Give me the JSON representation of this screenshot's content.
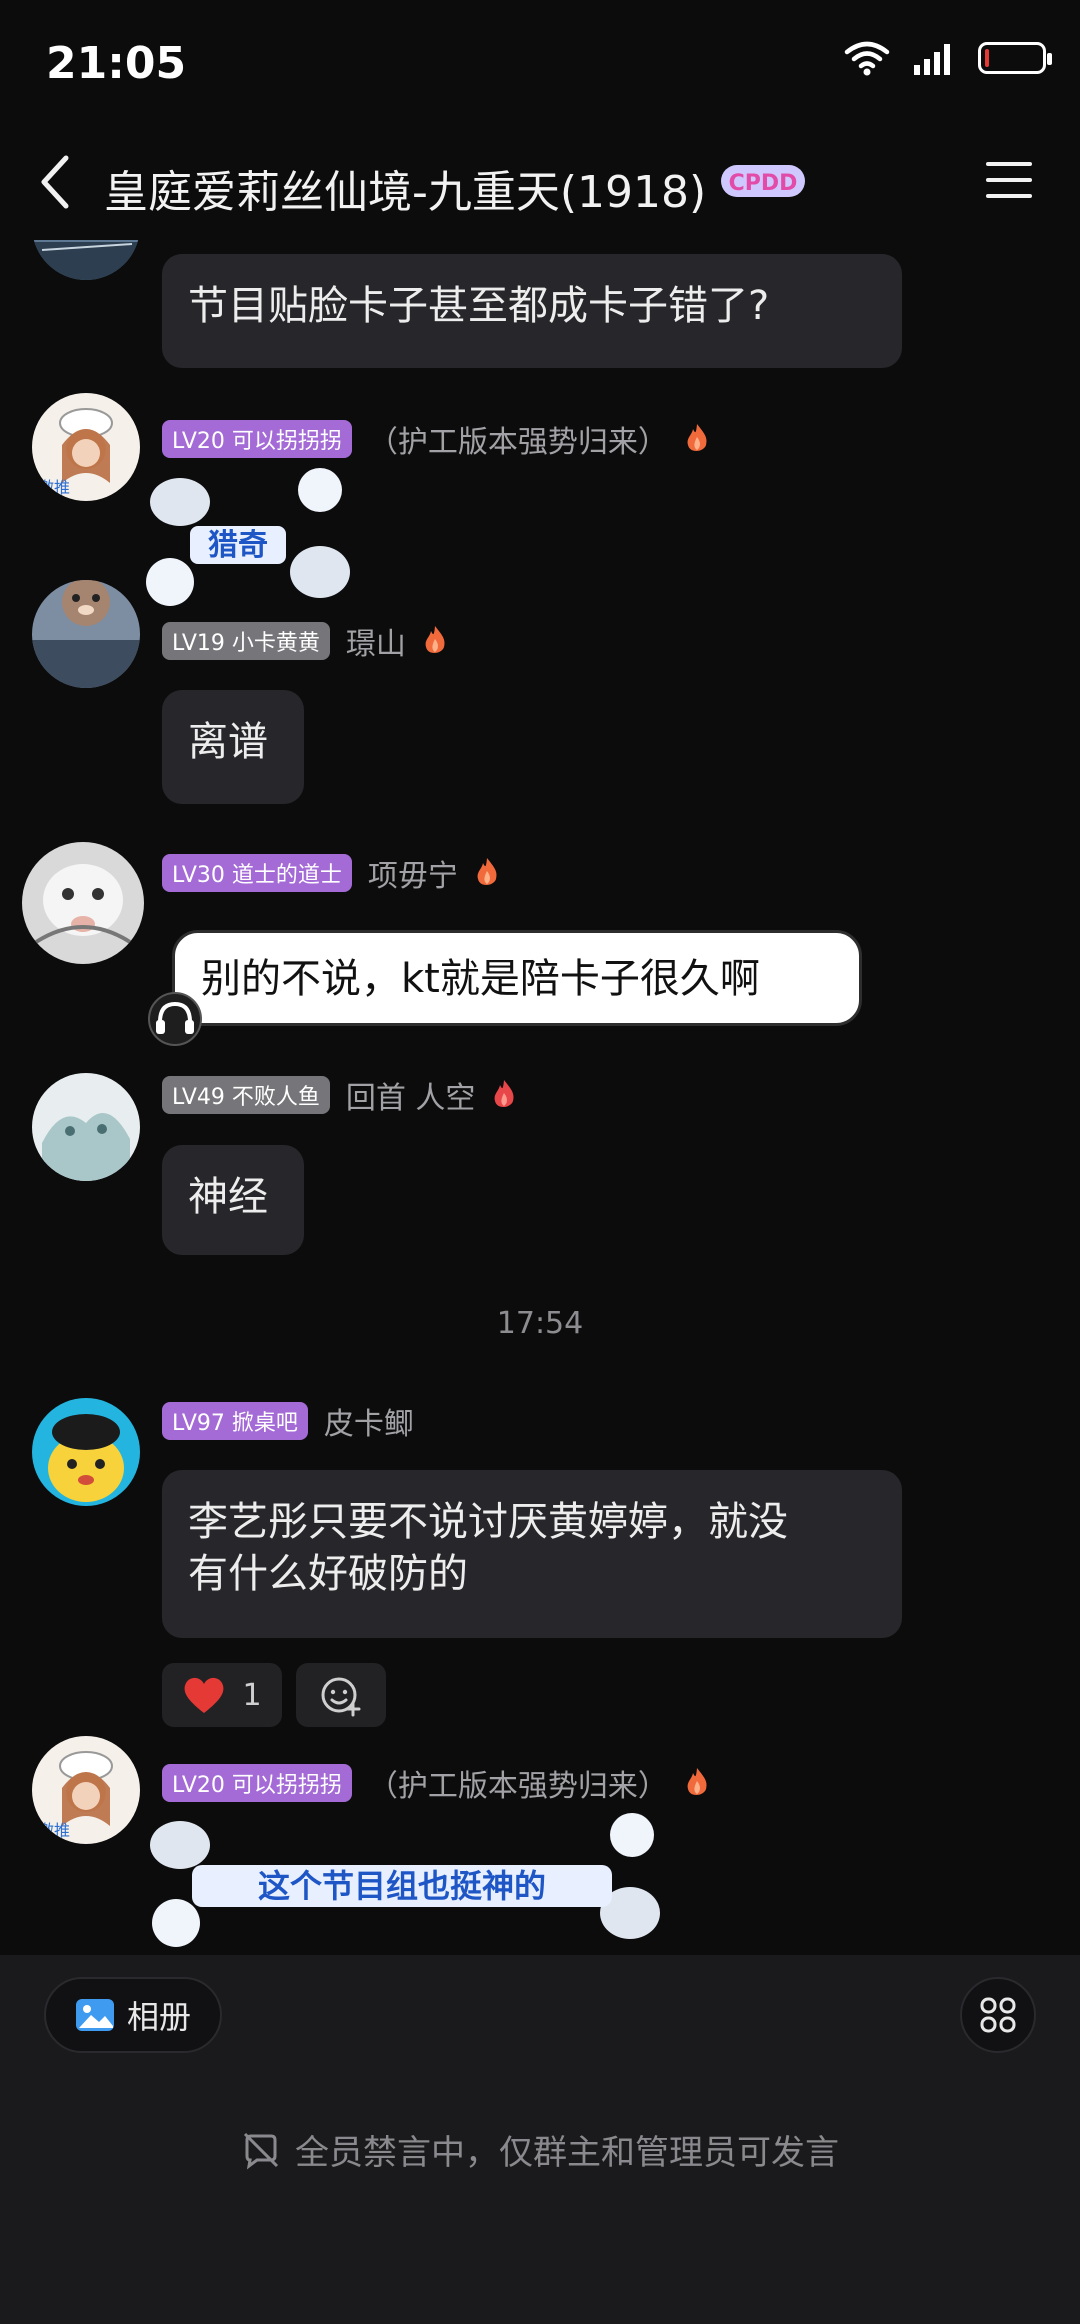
{
  "status_bar": {
    "time": "21:05",
    "battery_level": 0.08
  },
  "header": {
    "title": "皇庭爱莉丝仙境-九重天(1918)",
    "badge": "CPDD"
  },
  "messages": [
    {
      "text": "节目贴脸卡子甚至都成卡子错了?"
    },
    {
      "level": "LV20 可以拐拐拐",
      "nickname": "（护工版本强势归来）",
      "sticker_text": "猎奇"
    },
    {
      "level": "LV19 小卡黄黄",
      "nickname": "璟山",
      "text": "离谱"
    },
    {
      "level": "LV30 道士的道士",
      "nickname": "项毋宁",
      "text": "别的不说，kt就是陪卡子很久啊"
    },
    {
      "level": "LV49 不败人鱼",
      "nickname": "回首 人空",
      "text": "神经"
    },
    {
      "level": "LV97 掀桌吧",
      "nickname": "皮卡鲫",
      "text_line1": "李艺彤只要不说讨厌黄婷婷，就没",
      "text_line2": "有什么好破防的",
      "reaction_count": "1"
    },
    {
      "level": "LV20 可以拐拐拐",
      "nickname": "（护工版本强势归来）",
      "sticker_text": "这个节目组也挺神的"
    }
  ],
  "timestamp": "17:54",
  "bottom_bar": {
    "album_label": "相册",
    "mute_notice": "全员禁言中，仅群主和管理员可发言"
  },
  "colors": {
    "level_badge": "#a46bd6",
    "level_badge_gray": "#76767a",
    "bubble": "#27272b",
    "background": "#0c0c0d"
  }
}
